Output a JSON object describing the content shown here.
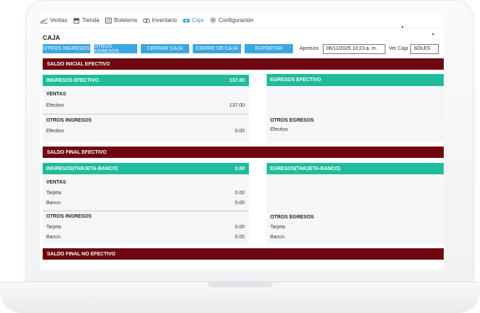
{
  "nav": {
    "items": [
      {
        "label": "Ventas",
        "icon": "chart-icon"
      },
      {
        "label": "Tienda",
        "icon": "store-icon"
      },
      {
        "label": "Boletería",
        "icon": "ticket-icon"
      },
      {
        "label": "Inventario",
        "icon": "inventory-icon"
      },
      {
        "label": "Caja",
        "icon": "cash-icon",
        "active": true
      },
      {
        "label": "Configuración",
        "icon": "gear-icon"
      }
    ]
  },
  "page": {
    "title": "CAJA"
  },
  "toolbar": {
    "buttons": [
      "OTROS INGRESOS",
      "OTROS EGRESOS",
      "CERRAR CAJA",
      "CIERRE DE CAJA",
      "EXPORTAR"
    ],
    "apertura_label": "Apertura",
    "apertura_value": "06/11/2025 10:23 a. m.",
    "ver_caja_label": "Ver Caja",
    "ver_caja_value": "SOLES"
  },
  "colors": {
    "accent": "#3ea6df",
    "band": "#6e0710",
    "card_header": "#1fbc9c"
  },
  "saldo_inicial": {
    "title": "SALDO INICIAL EFECTIVO",
    "ingresos": {
      "header": "INGRESOS EFECTIVO",
      "total": "137.00",
      "ventas_title": "VENTAS",
      "ventas": [
        {
          "label": "Efectivo",
          "value": "137.00"
        }
      ],
      "otros_title": "OTROS INGRESOS",
      "otros": [
        {
          "label": "Efectivo",
          "value": "0.00"
        }
      ]
    },
    "egresos": {
      "header": "EGRESOS EFECTIVO",
      "otros_title": "OTROS EGRESOS",
      "otros": [
        {
          "label": "Efectivo"
        }
      ]
    }
  },
  "saldo_final": {
    "title": "SALDO FINAL EFECTIVO",
    "ingresos": {
      "header": "INGRESOS(TARJETA-BANCO)",
      "total": "0.00",
      "ventas_title": "VENTAS",
      "ventas": [
        {
          "label": "Tarjeta",
          "value": "0.00"
        },
        {
          "label": "Banco",
          "value": "0.00"
        }
      ],
      "otros_title": "OTROS INGRESOS",
      "otros": [
        {
          "label": "Tarjeta",
          "value": "0.00"
        },
        {
          "label": "Banco",
          "value": "0.00"
        }
      ]
    },
    "egresos": {
      "header": "EGRESOS(TARJETA-BANCO)",
      "otros_title": "OTROS EGRESOS",
      "otros": [
        {
          "label": "Tarjeta"
        },
        {
          "label": "Banco"
        }
      ]
    }
  },
  "saldo_no_efectivo": {
    "title": "SALDO FINAL NO EFECTIVO"
  }
}
